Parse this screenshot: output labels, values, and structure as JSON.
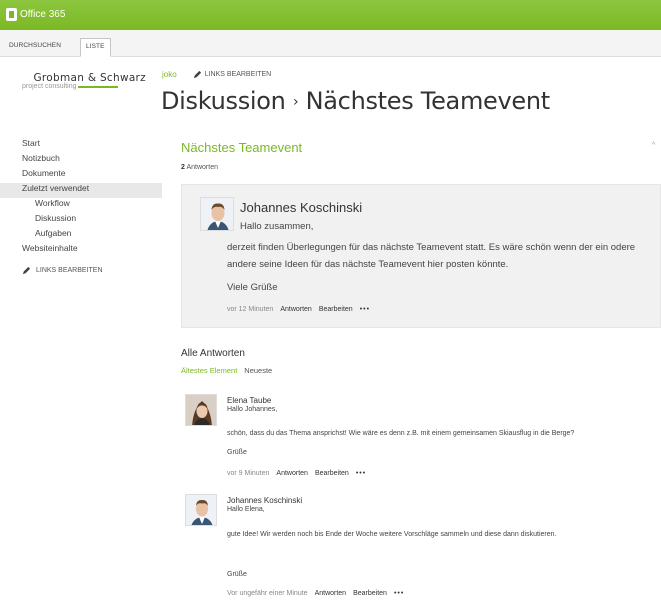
{
  "suite_bar": {
    "brand": "Office 365",
    "color": "#7cb824"
  },
  "ribbon": {
    "tabs": [
      "DURCHSUCHEN",
      "LISTE"
    ],
    "active": "LISTE"
  },
  "header": {
    "logo": {
      "name": "Grobman & Schwarz",
      "tagline": "project consulting"
    },
    "site_link": "joko",
    "edit_links": "LINKS BEARBEITEN",
    "title_part1": "Diskussion",
    "title_sep": "›",
    "title_part2": "Nächstes Teamevent"
  },
  "quick_launch": {
    "items": [
      "Start",
      "Notizbuch",
      "Dokumente",
      "Zuletzt verwendet",
      "Workflow",
      "Diskussion",
      "Aufgaben",
      "Websiteinhalte"
    ],
    "edit_links": "LINKS BEARBEITEN"
  },
  "thread": {
    "title": "Nächstes Teamevent",
    "reply_count": "2",
    "reply_count_label": "Antworten",
    "root": {
      "author": "Johannes Koschinski",
      "greeting": "Hallo zusammen,",
      "body": "derzeit finden Überlegungen für das nächste Teamevent statt. Es wäre schön wenn der ein odere andere seine Ideen für das nächste Teamevent hier posten könnte.",
      "closing": "Viele Grüße",
      "time": "vor 12 Minuten",
      "reply_label": "Antworten",
      "edit_label": "Bearbeiten",
      "more": "•••"
    },
    "all_answers_label": "Alle Antworten",
    "sort": {
      "oldest": "Ältestes Element",
      "newest": "Neueste"
    },
    "replies": [
      {
        "author": "Elena Taube",
        "greeting": "Hallo Johannes,",
        "body": "schön, dass du das Thema ansprichst! Wie wäre es denn z.B. mit einem gemeinsamen Skiausflug in die Berge?",
        "closing": "Grüße",
        "time": "vor 9 Minuten",
        "reply_label": "Antworten",
        "edit_label": "Bearbeiten",
        "more": "•••"
      },
      {
        "author": "Johannes Koschinski",
        "greeting": "Hallo Elena,",
        "body": "gute Idee! Wir werden noch bis Ende der Woche weitere Vorschläge sammeln und diese dann diskutieren.",
        "closing": "Grüße",
        "time": "Vor ungefähr einer Minute",
        "reply_label": "Antworten",
        "edit_label": "Bearbeiten",
        "more": "•••"
      }
    ]
  }
}
